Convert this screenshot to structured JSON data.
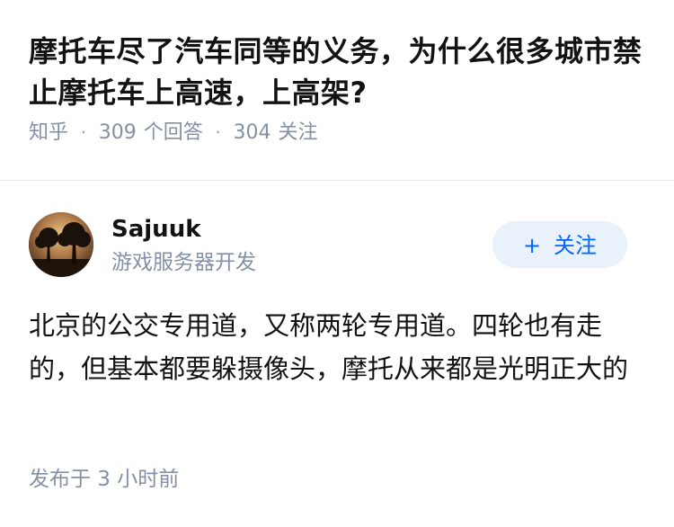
{
  "question": {
    "title": "摩托车尽了汽车同等的义务，为什么很多城市禁止摩托车上高速，上高架?",
    "source": "知乎",
    "answer_count": "309",
    "answer_label": "个回答",
    "follower_count": "304",
    "follower_label": "关注",
    "separator": "·"
  },
  "answer": {
    "author_name": "Sajuuk",
    "author_bio": "游戏服务器开发",
    "follow_button": {
      "icon": "+",
      "label": "关注"
    },
    "content": "北京的公交专用道，又称两轮专用道。四轮也有走的，但基本都要躲摄像头，摩托从来都是光明正大的",
    "published": "发布于 3 小时前"
  },
  "colors": {
    "accent": "#0066ff",
    "follow_bg": "#e9f1fb",
    "muted": "#8590a6",
    "text": "#121212"
  }
}
